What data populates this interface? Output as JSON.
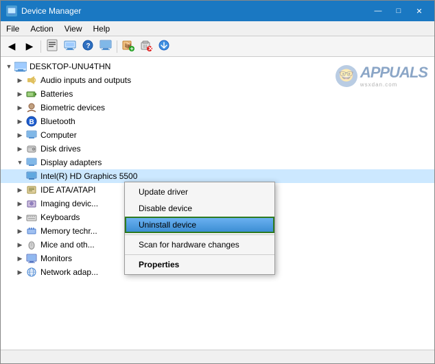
{
  "window": {
    "title": "Device Manager",
    "title_icon": "🖥️",
    "controls": {
      "minimize": "—",
      "maximize": "□",
      "close": "✕"
    }
  },
  "menu": {
    "items": [
      "File",
      "Action",
      "View",
      "Help"
    ]
  },
  "toolbar": {
    "buttons": [
      {
        "name": "back",
        "icon": "◀",
        "label": "Back"
      },
      {
        "name": "forward",
        "icon": "▶",
        "label": "Forward"
      },
      {
        "name": "properties",
        "icon": "📋",
        "label": "Properties"
      },
      {
        "name": "update",
        "icon": "🔄",
        "label": "Update Driver"
      },
      {
        "name": "help",
        "icon": "❓",
        "label": "Help"
      },
      {
        "name": "display",
        "icon": "🖥",
        "label": "Display"
      },
      {
        "name": "monitor",
        "icon": "📺",
        "label": "Monitor"
      },
      {
        "name": "add",
        "icon": "📦",
        "label": "Add"
      },
      {
        "name": "remove",
        "icon": "❌",
        "label": "Remove"
      },
      {
        "name": "scan",
        "icon": "⬇",
        "label": "Scan"
      }
    ]
  },
  "tree": {
    "root": {
      "label": "DESKTOP-UNU4THN",
      "icon": "💻"
    },
    "items": [
      {
        "label": "Audio inputs and outputs",
        "icon": "🔊",
        "indent": 1,
        "toggle": "▶"
      },
      {
        "label": "Batteries",
        "icon": "🔋",
        "indent": 1,
        "toggle": "▶"
      },
      {
        "label": "Biometric devices",
        "icon": "📷",
        "indent": 1,
        "toggle": "▶"
      },
      {
        "label": "Bluetooth",
        "icon": "🔵",
        "indent": 1,
        "toggle": "▶"
      },
      {
        "label": "Computer",
        "icon": "🖥",
        "indent": 1,
        "toggle": "▶"
      },
      {
        "label": "Disk drives",
        "icon": "💾",
        "indent": 1,
        "toggle": "▶"
      },
      {
        "label": "Display adapters",
        "icon": "🖥",
        "indent": 1,
        "toggle": "▼",
        "expanded": true
      },
      {
        "label": "Intel(R) HD Graphics 5500",
        "icon": "🖥",
        "indent": 2,
        "selected": true
      },
      {
        "label": "IDE ATA/ATAPI",
        "icon": "💾",
        "indent": 1,
        "toggle": "▶",
        "truncated": true
      },
      {
        "label": "Imaging devic...",
        "icon": "📷",
        "indent": 1,
        "toggle": "▶"
      },
      {
        "label": "Keyboards",
        "icon": "⌨",
        "indent": 1,
        "toggle": "▶"
      },
      {
        "label": "Memory techr...",
        "icon": "🗂",
        "indent": 1,
        "toggle": "▶"
      },
      {
        "label": "Mice and oth...",
        "icon": "🖱",
        "indent": 1,
        "toggle": "▶"
      },
      {
        "label": "Monitors",
        "icon": "🖥",
        "indent": 1,
        "toggle": "▶"
      },
      {
        "label": "Network adap...",
        "icon": "🌐",
        "indent": 1,
        "toggle": "▶"
      }
    ]
  },
  "context_menu": {
    "items": [
      {
        "label": "Update driver",
        "bold": false
      },
      {
        "label": "Disable device",
        "bold": false
      },
      {
        "label": "Uninstall device",
        "bold": false,
        "active": true
      },
      {
        "label": "Scan for hardware changes",
        "bold": false
      },
      {
        "label": "Properties",
        "bold": true
      }
    ]
  },
  "watermark": {
    "text": "APPUALS",
    "sub": "wsxdan.com"
  },
  "status_bar": {
    "text": ""
  }
}
